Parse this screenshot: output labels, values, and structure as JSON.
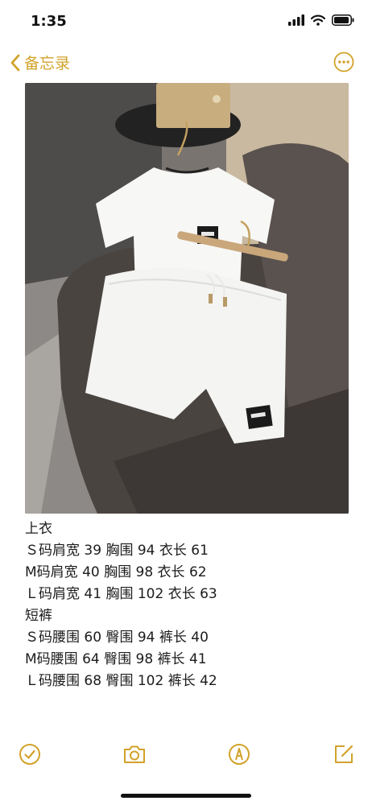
{
  "status": {
    "time": "1:35",
    "icons": [
      "cellular-signal-icon",
      "wifi-icon",
      "battery-icon"
    ]
  },
  "nav": {
    "back_label": "备忘录",
    "back_icon": "chevron-left-icon",
    "more_icon": "ellipsis-circle-icon"
  },
  "note": {
    "image_description_icon": "photo-attachment",
    "lines": [
      "上衣",
      "Ｓ码肩宽 39 胸围 94 衣长 61",
      "M码肩宽 40 胸围 98 衣长 62",
      "Ｌ码肩宽 41 胸围 102 衣长 63",
      "短裤",
      "Ｓ码腰围 60 臀围 94 裤长 40",
      "M码腰围 64 臀围 98 裤长 41",
      "Ｌ码腰围 68 臀围 102 裤长 42"
    ]
  },
  "toolbar": {
    "items": [
      "checklist-icon",
      "camera-icon",
      "markup-pen-icon",
      "compose-icon"
    ]
  },
  "colors": {
    "accent": "#d2a229",
    "text": "#1c1c1e"
  }
}
